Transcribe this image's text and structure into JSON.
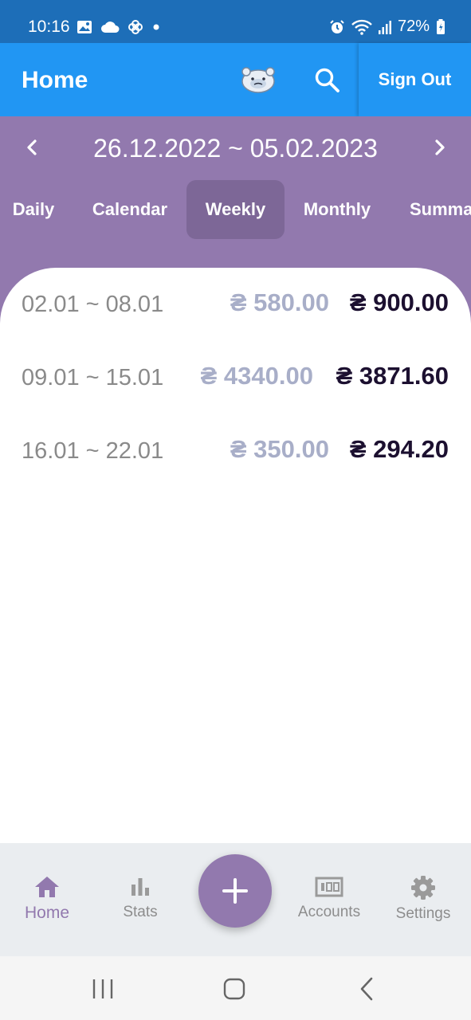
{
  "status_bar": {
    "time": "10:16",
    "battery": "72%",
    "left_icons": [
      "image-icon",
      "cloud-icon",
      "pinwheel-icon",
      "dot-icon"
    ],
    "right_icons": [
      "alarm-icon",
      "wifi-icon",
      "signal-icon",
      "battery-icon"
    ]
  },
  "app_bar": {
    "title": "Home",
    "sign_out_label": "Sign Out",
    "icons": [
      "mascot-icon",
      "search-icon"
    ]
  },
  "period": {
    "range": "26.12.2022 ~ 05.02.2023"
  },
  "tabs": [
    {
      "label": "Daily",
      "active": false
    },
    {
      "label": "Calendar",
      "active": false
    },
    {
      "label": "Weekly",
      "active": true
    },
    {
      "label": "Monthly",
      "active": false
    },
    {
      "label": "Summa",
      "active": false
    }
  ],
  "weeks": [
    {
      "dates": "02.01 ~ 08.01",
      "income": "₴ 580.00",
      "expense": "₴ 900.00"
    },
    {
      "dates": "09.01 ~ 15.01",
      "income": "₴ 4340.00",
      "expense": "₴ 3871.60"
    },
    {
      "dates": "16.01 ~ 22.01",
      "income": "₴ 350.00",
      "expense": "₴ 294.20"
    }
  ],
  "bottom_nav": [
    {
      "label": "Home",
      "icon": "home-icon",
      "active": true
    },
    {
      "label": "Stats",
      "icon": "bar-chart-icon",
      "active": false
    },
    {
      "label": "Accounts",
      "icon": "accounts-icon",
      "active": false
    },
    {
      "label": "Settings",
      "icon": "gear-icon",
      "active": false
    }
  ],
  "colors": {
    "status_bar": "#1d6eb8",
    "app_bar": "#2196f3",
    "accent_purple": "#9279ae",
    "active_tab": "#7d6797",
    "income_text": "#a8aec8",
    "expense_text": "#1c1030"
  }
}
